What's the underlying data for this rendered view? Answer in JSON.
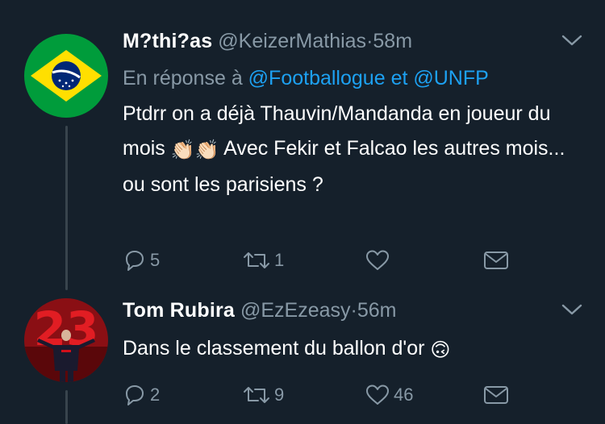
{
  "tweets": [
    {
      "name": "M?thi?as",
      "handle": "@KeizerMathias",
      "separator": "·",
      "time": "58m",
      "reply_prefix": "En réponse à",
      "reply_mention_1": "@Footballogue",
      "reply_joiner": "et",
      "reply_mention_2": "@UNFP",
      "text_part1": "Ptdrr on a déjà Thauvin/Mandanda en joueur du mois",
      "emoji": "👏🏻👏🏻",
      "text_part2": "Avec Fekir et Falcao les autres mois... ou sont les parisiens ?",
      "avatar_icon": "brazil-flag",
      "replies": "5",
      "retweets": "1",
      "likes": ""
    },
    {
      "name": "Tom Rubira",
      "handle": "@EzEzeasy",
      "separator": "·",
      "time": "56m",
      "text_part1": "Dans le classement du ballon d'or",
      "emoji": "🙃",
      "avatar_icon": "football-player-23",
      "replies": "2",
      "retweets": "9",
      "likes": "46"
    }
  ],
  "colors": {
    "background": "#15202b",
    "text": "#ffffff",
    "secondary": "#8899a6",
    "link": "#1da1f2",
    "thread_line": "#38444d"
  }
}
